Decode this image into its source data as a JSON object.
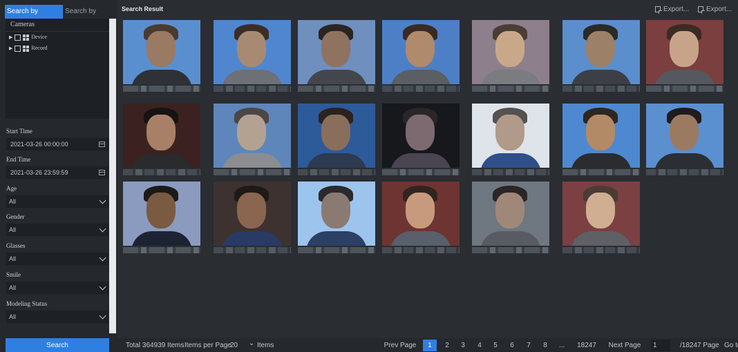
{
  "tabs": [
    "Search by Attribute",
    "Search by Picture"
  ],
  "cameras": {
    "header": "Cameras",
    "items": [
      "Device",
      "Record"
    ]
  },
  "filters": {
    "start_time_label": "Start Time",
    "start_time_value": "2021-03-26 00:00:00",
    "end_time_label": "End Time",
    "end_time_value": "2021-03-26 23:59:59",
    "age_label": "Age",
    "age_value": "All",
    "gender_label": "Gender",
    "gender_value": "All",
    "glasses_label": "Glasses",
    "glasses_value": "All",
    "smile_label": "Smile",
    "smile_value": "All",
    "modeling_label": "Modeling Status",
    "modeling_value": "All"
  },
  "search_button": "Search",
  "result": {
    "title": "Search Result",
    "export_label_1": "Export...",
    "export_label_2": "Export..."
  },
  "pagination": {
    "total": "Total 364939 Items",
    "items_per_page_label": "Items per Page",
    "items_per_page_value": "20",
    "items_suffix": "Items",
    "prev": "Prev Page",
    "pages": [
      "1",
      "2",
      "3",
      "4",
      "5",
      "6",
      "7",
      "8",
      "...",
      "18247"
    ],
    "current": "1",
    "next": "Next Page",
    "goto_value": "1",
    "total_pages": "/18247 Page",
    "goto": "Go to"
  },
  "colors": {
    "accent": "#2f7fe3",
    "background": "#2a2d32",
    "panel": "#25282c"
  }
}
